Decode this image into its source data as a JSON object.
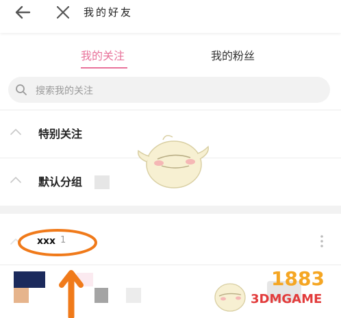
{
  "header": {
    "title": "我的好友",
    "back_icon": "arrow-left-icon",
    "close_icon": "close-icon"
  },
  "tabs": [
    {
      "label": "我的关注",
      "active": true
    },
    {
      "label": "我的粉丝",
      "active": false
    }
  ],
  "search": {
    "placeholder": "搜索我的关注",
    "icon": "search-icon"
  },
  "groups": [
    {
      "label": "特别关注",
      "icon": "chevron-up-icon"
    },
    {
      "label": "默认分组",
      "icon": "chevron-up-icon"
    }
  ],
  "user": {
    "name": "xxx",
    "count": "1",
    "more_icon": "more-vertical-icon"
  },
  "watermark": {
    "brand_a": "3DMGAME",
    "brand_b": "1883"
  },
  "colors": {
    "accent": "#e8729a",
    "annotation": "#f07a1a",
    "search_bg": "#f2f2f2",
    "separator": "#f2f2f2"
  }
}
